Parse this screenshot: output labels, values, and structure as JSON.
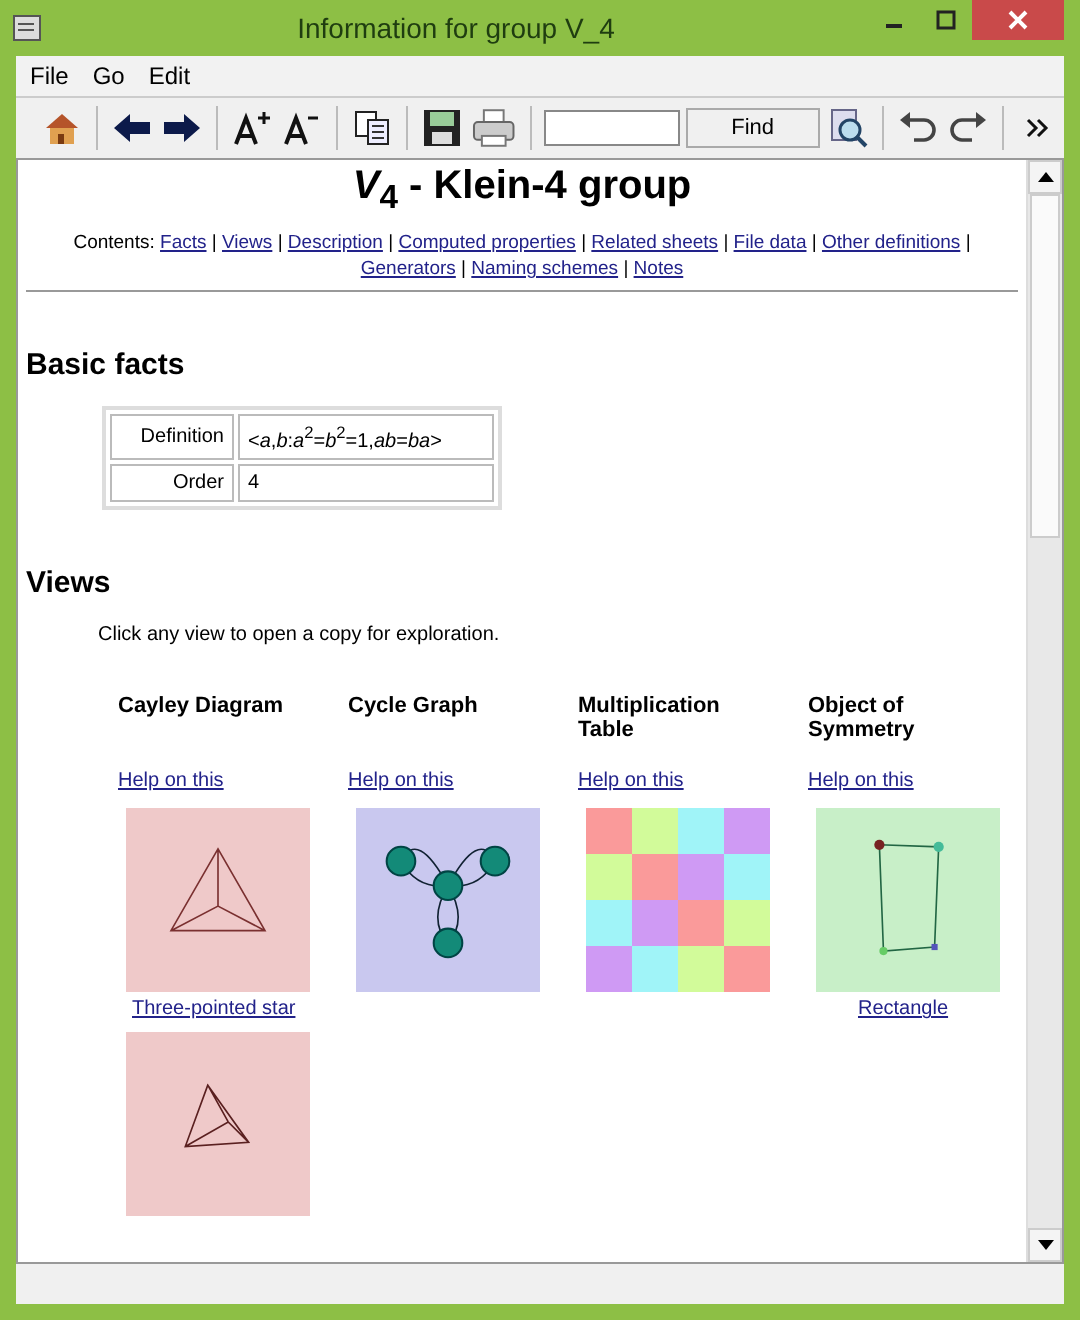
{
  "window": {
    "title": "Information for group V_4"
  },
  "menu": [
    "File",
    "Go",
    "Edit"
  ],
  "toolbar": {
    "find_button": "Find"
  },
  "page": {
    "title": "*V*$_{4}$ - Klein-4 group",
    "contents_label": "Contents:",
    "contents_separator": "|",
    "contents_links": [
      "Facts",
      "Views",
      "Description",
      "Computed properties",
      "Related sheets",
      "File data",
      "Other definitions",
      "Generators",
      "Naming schemes",
      "Notes"
    ],
    "facts_heading": "Basic facts",
    "facts": [
      {
        "label": "Definition",
        "value": "<*a*,*b*:*a*$^{2}$=*b*$^{2}$=1,*ab*=*ba*>"
      },
      {
        "label": "Order",
        "value": "4"
      }
    ],
    "views_heading": "Views",
    "views_intro": "Click any view to open a copy for exploration.",
    "views": [
      {
        "title": "Cayley Diagram",
        "help": "Help on this",
        "kind": "cayley",
        "caption": "Three-pointed star"
      },
      {
        "title": "Cycle Graph",
        "help": "Help on this",
        "kind": "cycle"
      },
      {
        "title": "Multiplication Table",
        "help": "Help on this",
        "kind": "table"
      },
      {
        "title": "Object of Symmetry",
        "help": "Help on this",
        "kind": "symmetry",
        "caption": "Rectangle"
      },
      {
        "kind": "cayley2"
      }
    ]
  }
}
